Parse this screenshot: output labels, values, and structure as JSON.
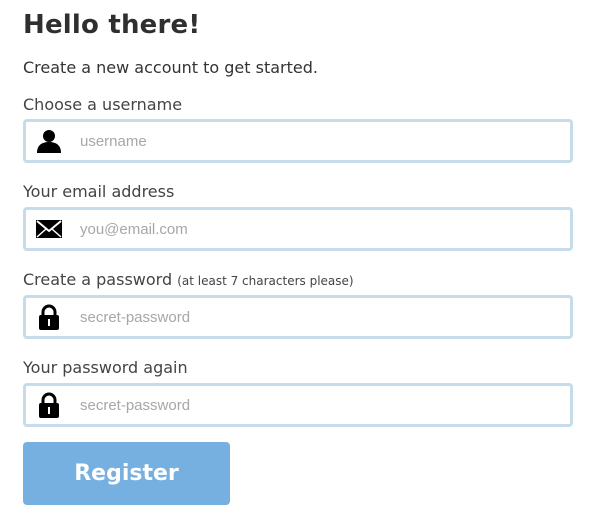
{
  "header": {
    "title": "Hello there!",
    "subtitle": "Create a new account to get started."
  },
  "fields": {
    "username": {
      "label": "Choose a username",
      "placeholder": "username",
      "value": "",
      "icon": "user-icon"
    },
    "email": {
      "label": "Your email address",
      "placeholder": "you@email.com",
      "value": "",
      "icon": "envelope-icon"
    },
    "password": {
      "label": "Create a password",
      "hint": "(at least 7 characters please)",
      "placeholder": "secret-password",
      "value": "",
      "icon": "lock-icon"
    },
    "password_again": {
      "label": "Your password again",
      "placeholder": "secret-password",
      "value": "",
      "icon": "lock-icon"
    }
  },
  "actions": {
    "register_label": "Register"
  },
  "colors": {
    "accent": "#75b0e0",
    "field_border": "#c6dcea",
    "text": "#333333",
    "placeholder": "#a7a7a7"
  }
}
